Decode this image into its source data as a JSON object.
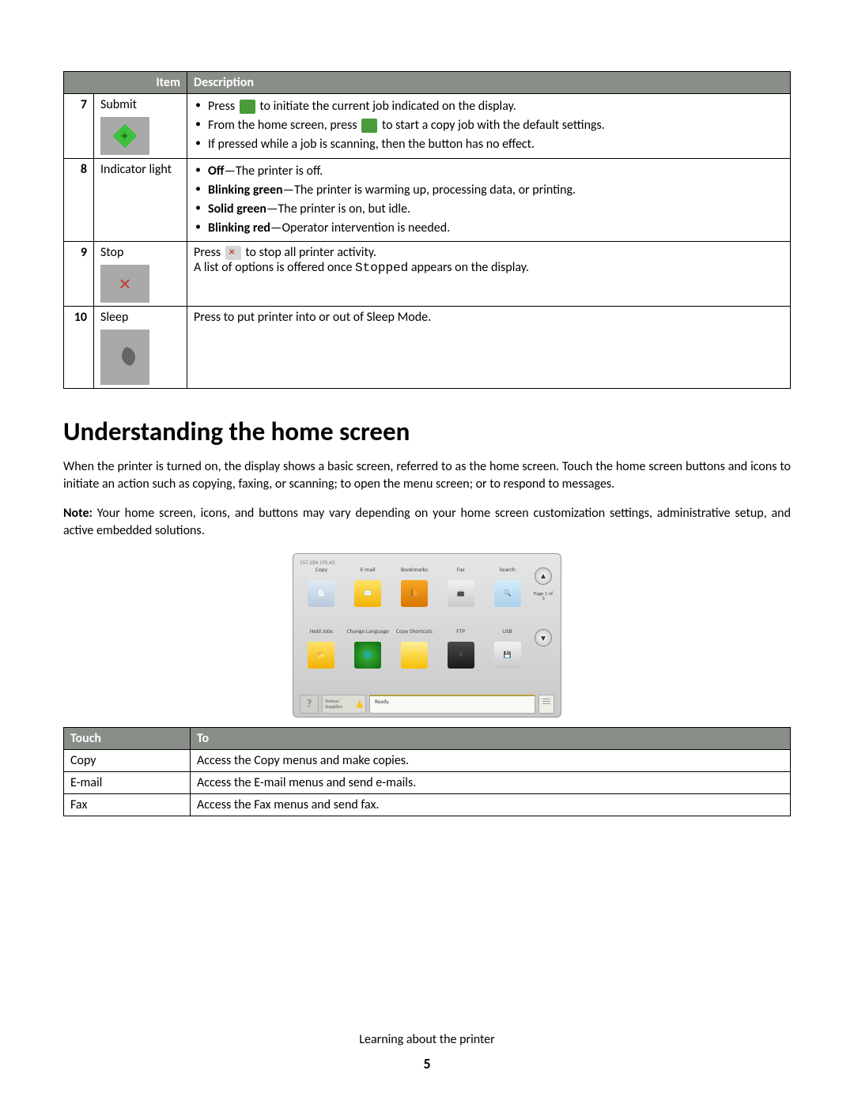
{
  "table1": {
    "headers": {
      "item": "Item",
      "desc": "Description"
    },
    "rows": [
      {
        "num": "7",
        "name": "Submit",
        "icon": "submit",
        "bullets": [
          {
            "pre": "Press ",
            "icontype": "green",
            "post": " to initiate the current job indicated on the display."
          },
          {
            "pre": "From the home screen, press ",
            "icontype": "green",
            "post": " to start a copy job with the default settings."
          },
          {
            "pre": "If pressed while a job is scanning, then the button has no effect.",
            "icontype": null,
            "post": ""
          }
        ]
      },
      {
        "num": "8",
        "name": "Indicator light",
        "icon": null,
        "states": [
          {
            "label": "Off",
            "text": "—The printer is off."
          },
          {
            "label": "Blinking green",
            "text": "—The printer is warming up, processing data, or printing."
          },
          {
            "label": "Solid green",
            "text": "—The printer is on, but idle."
          },
          {
            "label": "Blinking red",
            "text": "—Operator intervention is needed."
          }
        ]
      },
      {
        "num": "9",
        "name": "Stop",
        "icon": "stop",
        "line1_pre": "Press ",
        "line1_post": " to stop all printer activity.",
        "line2_pre": "A list of options is offered once ",
        "line2_code": "Stopped",
        "line2_post": " appears on the display."
      },
      {
        "num": "10",
        "name": "Sleep",
        "icon": "sleep",
        "text": "Press to put printer into or out of Sleep Mode."
      }
    ]
  },
  "heading": "Understanding the home screen",
  "para1": "When the printer is turned on, the display shows a basic screen, referred to as the home screen. Touch the home screen buttons and icons to initiate an action such as copying, faxing, or scanning; to open the menu screen; or to respond to messages.",
  "para2_pre": "Note:",
  "para2": " Your home screen, icons, and buttons may vary depending on your home screen customization settings, administrative setup, and active embedded solutions.",
  "screen": {
    "ip": "157.184.195.43",
    "row1": [
      "Copy",
      "E-mail",
      "Bookmarks",
      "Fax",
      "Search"
    ],
    "row2": [
      "Held Jobs",
      "Change Language",
      "Copy Shortcuts",
      "FTP",
      "USB"
    ],
    "page": "Page 1 of 3",
    "status_label": "Status/ Supplies",
    "ready": "Ready."
  },
  "table2": {
    "headers": {
      "touch": "Touch",
      "to": "To"
    },
    "rows": [
      {
        "touch": "Copy",
        "to": "Access the Copy menus and make copies."
      },
      {
        "touch": "E-mail",
        "to": "Access the E-mail menus and send e-mails."
      },
      {
        "touch": "Fax",
        "to": "Access the Fax menus and send fax."
      }
    ]
  },
  "footer": {
    "section": "Learning about the printer",
    "page": "5"
  }
}
